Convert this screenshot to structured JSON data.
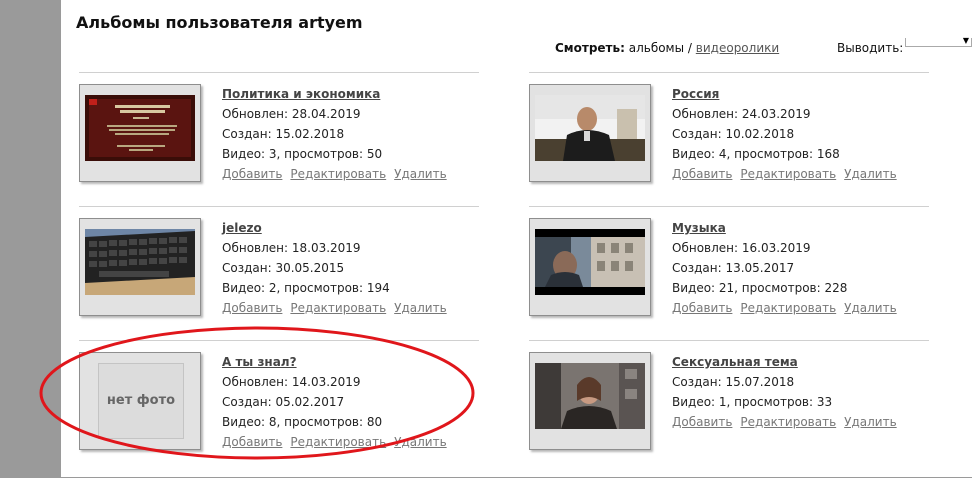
{
  "header": {
    "title": "Альбомы пользователя artyem",
    "view_label": "Смотреть:",
    "view_albums": "альбомы",
    "separator": "/",
    "view_videos": "видеоролики",
    "output_label": "Выводить:",
    "output_value": "",
    "output_arrow": "▼"
  },
  "albums": [
    {
      "title": "Политика и экономика",
      "updated": "Обновлен: 28.04.2019",
      "created": "Создан: 15.02.2018",
      "stats": "Видео: 3, просмотров: 50",
      "thumb": "slide-dark-red"
    },
    {
      "title": "Россия",
      "updated": "Обновлен: 24.03.2019",
      "created": "Создан: 10.02.2018",
      "stats": "Видео: 4, просмотров: 168",
      "thumb": "man-at-desk"
    },
    {
      "title": "jelezo",
      "updated": "Обновлен: 18.03.2019",
      "created": "Создан: 30.05.2015",
      "stats": "Видео: 2, просмотров: 194",
      "thumb": "keyboard"
    },
    {
      "title": "Музыка",
      "updated": "Обновлен: 16.03.2019",
      "created": "Создан: 13.05.2017",
      "stats": "Видео: 21, просмотров: 228",
      "thumb": "street-scene"
    },
    {
      "title": "А ты знал?",
      "updated": "Обновлен: 14.03.2019",
      "created": "Создан: 05.02.2017",
      "stats": "Видео: 8, просмотров: 80",
      "thumb": "no-photo",
      "nofoto_text": "нет фото"
    },
    {
      "title": "Сексуальная тема",
      "updated": "",
      "created": "Создан: 15.07.2018",
      "stats": "Видео: 1, просмотров: 33",
      "thumb": "woman-studio"
    }
  ],
  "actions": {
    "add": "Добавить",
    "edit": "Редактировать",
    "delete": "Удалить"
  },
  "colors": {
    "annotation": "#e0161b",
    "background": "#9a9a9a"
  }
}
